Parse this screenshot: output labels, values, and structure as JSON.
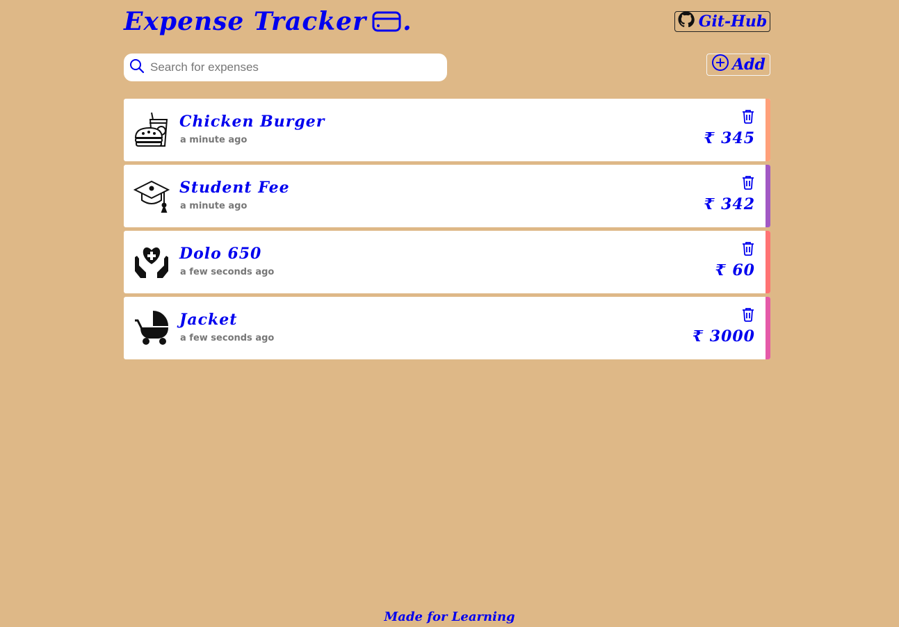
{
  "app": {
    "title": "Expense Tracker",
    "title_suffix": ".",
    "github_label": "Git-Hub",
    "add_label": "Add",
    "accent_color": "#0000ee",
    "background_color": "#deb887"
  },
  "search": {
    "placeholder": "Search for expenses",
    "value": ""
  },
  "expenses": [
    {
      "title": "Chicken Burger",
      "time": "a minute ago",
      "amount": "₹ 345",
      "icon": "food-icon",
      "stripe_color": "#ffa07a"
    },
    {
      "title": "Student Fee",
      "time": "a minute ago",
      "amount": "₹ 342",
      "icon": "graduation-cap-icon",
      "stripe_color": "#a259c4"
    },
    {
      "title": "Dolo 650",
      "time": "a few seconds ago",
      "amount": "₹ 60",
      "icon": "health-care-icon",
      "stripe_color": "#ff7373"
    },
    {
      "title": "Jacket",
      "time": "a few seconds ago",
      "amount": "₹ 3000",
      "icon": "baby-stroller-icon",
      "stripe_color": "#e55aa8"
    }
  ],
  "footer": {
    "text": "Made for Learning"
  }
}
